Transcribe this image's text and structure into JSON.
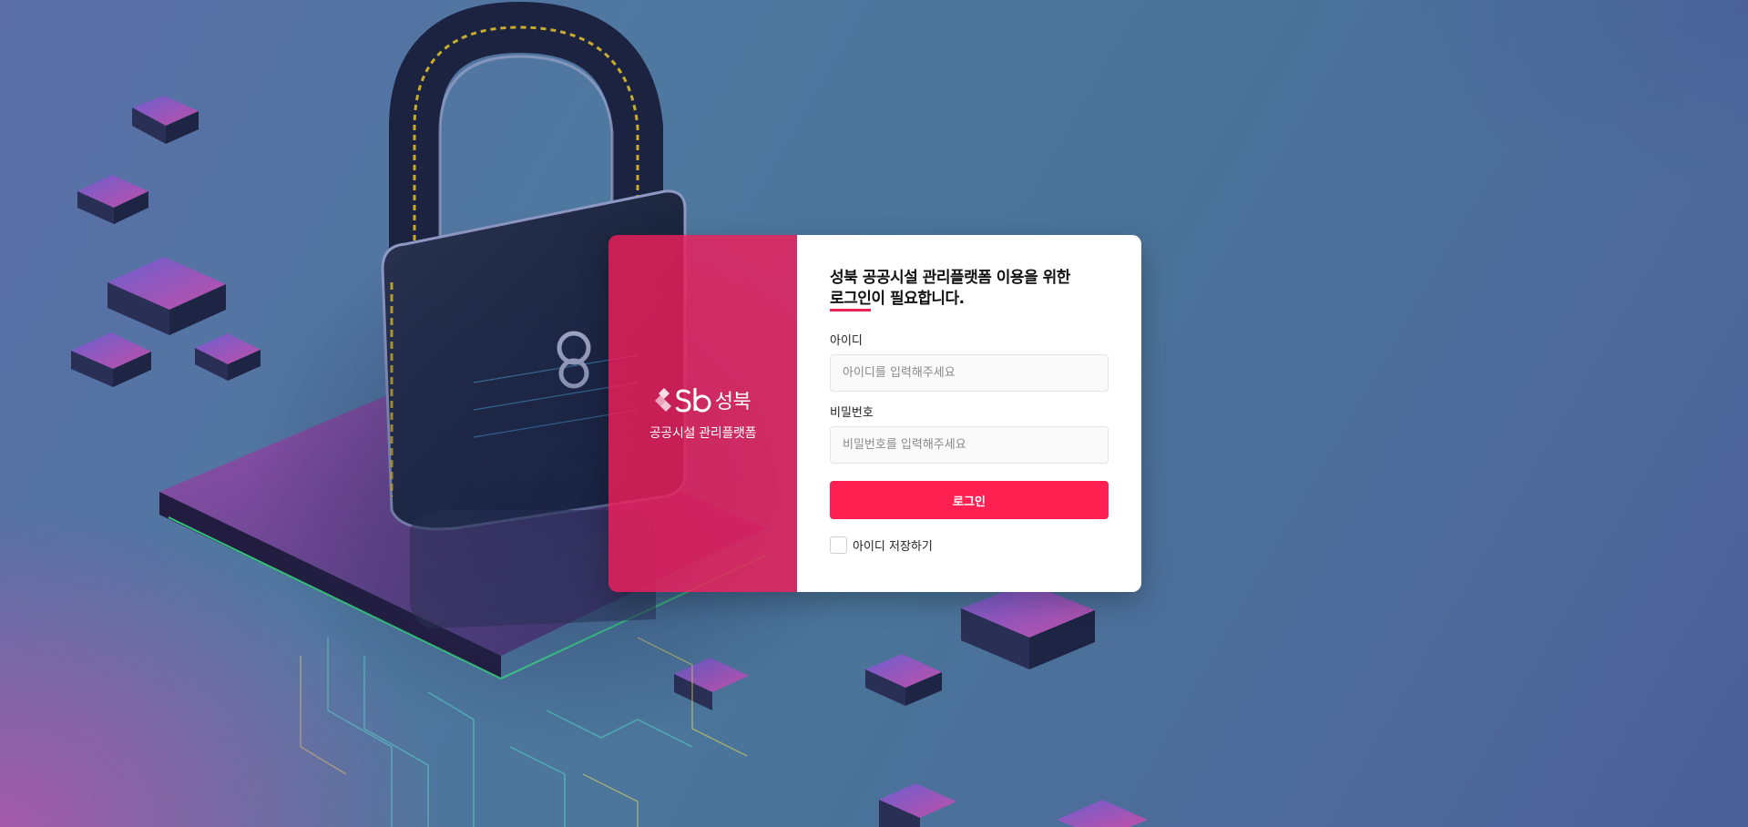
{
  "brand": {
    "logo_text": "성북",
    "subtitle": "공공시설 관리플랫폼"
  },
  "login": {
    "heading_line1": "성북 공공시설 관리플랫폼 이용을 위한",
    "heading_emphasis": "로그인",
    "heading_rest": "이 필요합니다.",
    "id_label": "아이디",
    "id_placeholder": "아이디를 입력해주세요",
    "id_value": "",
    "password_label": "비밀번호",
    "password_placeholder": "비밀번호를 입력해주세요",
    "password_value": "",
    "submit_label": "로그인",
    "remember_label": "아이디 저장하기",
    "remember_checked": false
  },
  "colors": {
    "accent": "#ff2052",
    "brand_panel": "#ee1e5a",
    "card_background": "#ffffff"
  }
}
